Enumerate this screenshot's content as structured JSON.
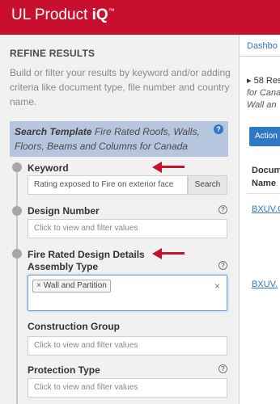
{
  "header": {
    "logo_prefix": "UL Product ",
    "logo_bold": "iQ",
    "logo_tm": "™"
  },
  "sidebar": {
    "title": "REFINE RESULTS",
    "description": "Build or filter your results by keyword and/or adding criteria like document type, file number and country name.",
    "template_label": "Search Template",
    "template_value": "Fire Rated Roofs, Walls, Floors, Beams and Columns for Canada",
    "help_glyph": "?",
    "keyword": {
      "label": "Keyword",
      "value": "Rating exposed to Fire on exterior face",
      "button": "Search"
    },
    "design_number": {
      "label": "Design Number",
      "placeholder": "Click to view and filter values"
    },
    "fire_rated": {
      "section_label": "Fire Rated Design Details",
      "assembly_label": "Assembly Type",
      "chip_remove": "×",
      "chip": "Wall and Partition",
      "clear": "×"
    },
    "construction_group": {
      "label": "Construction Group",
      "placeholder": "Click to view and filter values"
    },
    "protection_type": {
      "label": "Protection Type",
      "placeholder": "Click to view and filter values"
    }
  },
  "main": {
    "tab": "Dashbo",
    "results_line1": "58 Res",
    "results_line2": "for Cana",
    "results_line3": "Wall an",
    "action_button": "Action",
    "column_header_line1": "Docum",
    "column_header_line2": "Name",
    "links": [
      "BXUV.C",
      "BXUV."
    ]
  },
  "colors": {
    "brand_red": "#c8102e",
    "template_bg": "#b5c6de",
    "link_blue": "#2f78c4"
  }
}
